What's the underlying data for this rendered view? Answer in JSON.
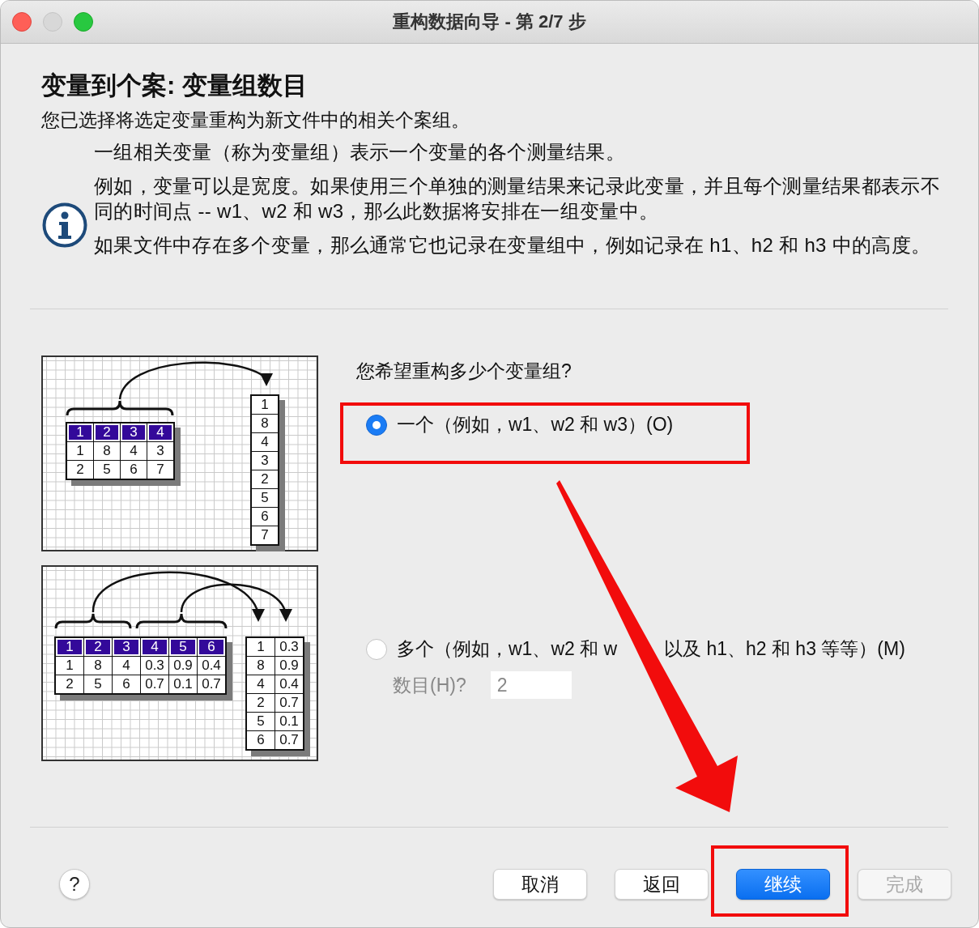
{
  "window": {
    "title": "重构数据向导 - 第 2/7 步"
  },
  "heading": "变量到个案: 变量组数目",
  "intro": "您已选择将选定变量重构为新文件中的相关个案组。",
  "info": [
    "一组相关变量（称为变量组）表示一个变量的各个测量结果。",
    "例如，变量可以是宽度。如果使用三个单独的测量结果来记录此变量，并且每个测量结果都表示不同的时间点 -- w1、w2 和 w3，那么此数据将安排在一组变量中。",
    "如果文件中存在多个变量，那么通常它也记录在变量组中，例如记录在 h1、h2 和 h3 中的高度。"
  ],
  "diagrams": [
    {
      "kind": "single",
      "headers": [
        "1",
        "2",
        "3",
        "4"
      ],
      "rows": [
        [
          "1",
          "8",
          "4",
          "3"
        ],
        [
          "2",
          "5",
          "6",
          "7"
        ]
      ],
      "result": [
        [
          "1",
          "8",
          "4",
          "3",
          "2",
          "5",
          "6",
          "7"
        ]
      ]
    },
    {
      "kind": "multiple",
      "headers": [
        "1",
        "2",
        "3",
        "4",
        "5",
        "6"
      ],
      "rows": [
        [
          "1",
          "8",
          "4",
          "0.3",
          "0.9",
          "0.4"
        ],
        [
          "2",
          "5",
          "6",
          "0.7",
          "0.1",
          "0.7"
        ]
      ],
      "result": [
        [
          "1",
          "8",
          "4",
          "2",
          "5",
          "6"
        ],
        [
          "0.3",
          "0.9",
          "0.4",
          "0.7",
          "0.1",
          "0.7"
        ]
      ]
    }
  ],
  "question": "您希望重构多少个变量组?",
  "options": [
    {
      "label": "一个（例如，w1、w2 和 w3）(O)",
      "selected": true,
      "highlighted": true
    },
    {
      "label_parts": [
        "多个（例如，w1、w2 和 w",
        "以及 h1、h2 和 h3 等等）(M)"
      ],
      "selected": false,
      "highlighted": false
    }
  ],
  "count": {
    "label": "数目(H)?",
    "value": "2",
    "disabled": true
  },
  "help": "?",
  "buttons": [
    {
      "label": "取消",
      "kind": "normal",
      "disabled": false,
      "highlighted": false
    },
    {
      "label": "返回",
      "kind": "normal",
      "disabled": false,
      "highlighted": false
    },
    {
      "label": "继续",
      "kind": "default",
      "disabled": false,
      "highlighted": true
    },
    {
      "label": "完成",
      "kind": "normal",
      "disabled": true,
      "highlighted": false
    }
  ],
  "annotation_arrow": true
}
